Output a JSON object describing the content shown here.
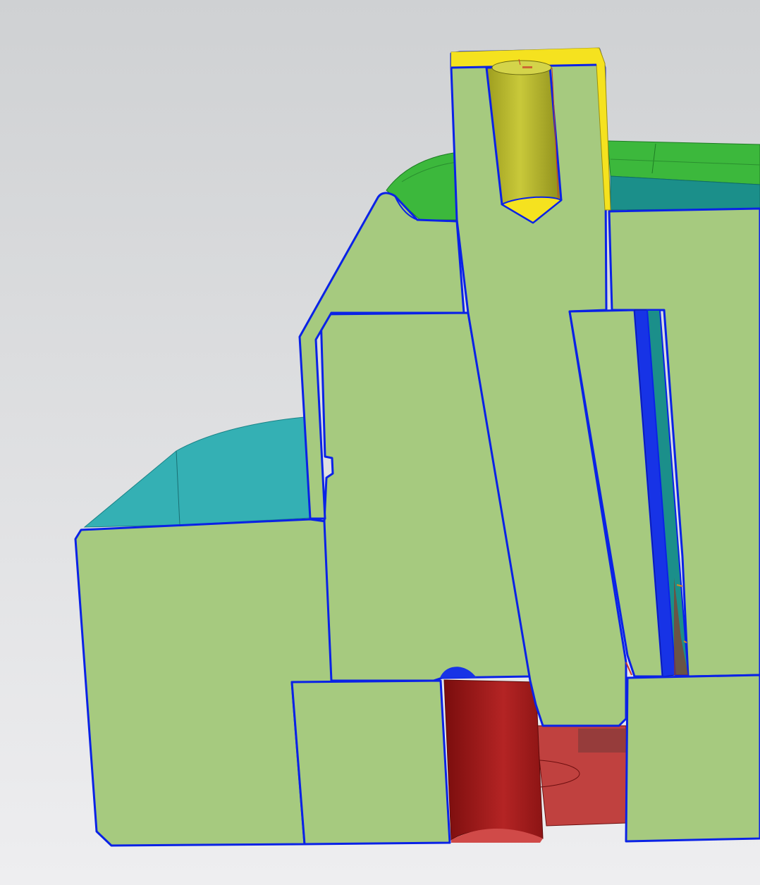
{
  "viewport": {
    "background_top": "#cfd1d3",
    "background_bottom": "#eeeef0"
  },
  "colors": {
    "section_face": "#a6ca7f",
    "section_edge": "#0a22e6",
    "teal_surface": "#34b0b4",
    "teal_dark": "#1b8f8a",
    "green_rim": "#3cb83c",
    "green_rim_dark": "#2a9a2f",
    "yellow_pin": "#bcbc2e",
    "yellow_cap": "#f5e21f",
    "red_bore": "#a51d1d",
    "red_bore_light": "#c0413f",
    "blue_channel": "#1733e6"
  }
}
